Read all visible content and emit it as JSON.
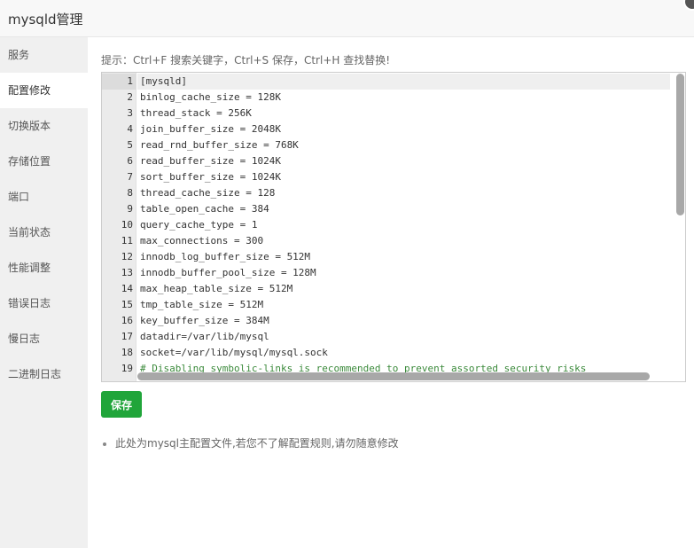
{
  "window": {
    "title": "mysqld管理"
  },
  "sidebar": {
    "items": [
      {
        "label": "服务",
        "active": false
      },
      {
        "label": "配置修改",
        "active": true
      },
      {
        "label": "切换版本",
        "active": false
      },
      {
        "label": "存储位置",
        "active": false
      },
      {
        "label": "端口",
        "active": false
      },
      {
        "label": "当前状态",
        "active": false
      },
      {
        "label": "性能调整",
        "active": false
      },
      {
        "label": "错误日志",
        "active": false
      },
      {
        "label": "慢日志",
        "active": false
      },
      {
        "label": "二进制日志",
        "active": false
      }
    ]
  },
  "main": {
    "tip": "提示：Ctrl+F 搜索关键字，Ctrl+S 保存，Ctrl+H 查找替换!",
    "editor": {
      "lines": [
        {
          "num": "1",
          "text": "[mysqld]"
        },
        {
          "num": "2",
          "text": "binlog_cache_size = 128K"
        },
        {
          "num": "3",
          "text": "thread_stack = 256K"
        },
        {
          "num": "4",
          "text": "join_buffer_size = 2048K"
        },
        {
          "num": "5",
          "text": "read_rnd_buffer_size = 768K"
        },
        {
          "num": "6",
          "text": "read_buffer_size = 1024K"
        },
        {
          "num": "7",
          "text": "sort_buffer_size = 1024K"
        },
        {
          "num": "8",
          "text": "thread_cache_size = 128"
        },
        {
          "num": "9",
          "text": "table_open_cache = 384"
        },
        {
          "num": "10",
          "text": "query_cache_type = 1"
        },
        {
          "num": "11",
          "text": "max_connections = 300"
        },
        {
          "num": "12",
          "text": "innodb_log_buffer_size = 512M"
        },
        {
          "num": "13",
          "text": "innodb_buffer_pool_size = 128M"
        },
        {
          "num": "14",
          "text": "max_heap_table_size = 512M"
        },
        {
          "num": "15",
          "text": "tmp_table_size = 512M"
        },
        {
          "num": "16",
          "text": "key_buffer_size = 384M"
        },
        {
          "num": "17",
          "text": "datadir=/var/lib/mysql"
        },
        {
          "num": "18",
          "text": "socket=/var/lib/mysql/mysql.sock"
        },
        {
          "num": "19",
          "text": "# Disabling symbolic-links is recommended to prevent assorted security risks"
        }
      ]
    },
    "save_label": "保存",
    "note": "此处为mysql主配置文件,若您不了解配置规则,请勿随意修改"
  },
  "colors": {
    "accent": "#20a53a",
    "comment": "#3b8a3b"
  }
}
